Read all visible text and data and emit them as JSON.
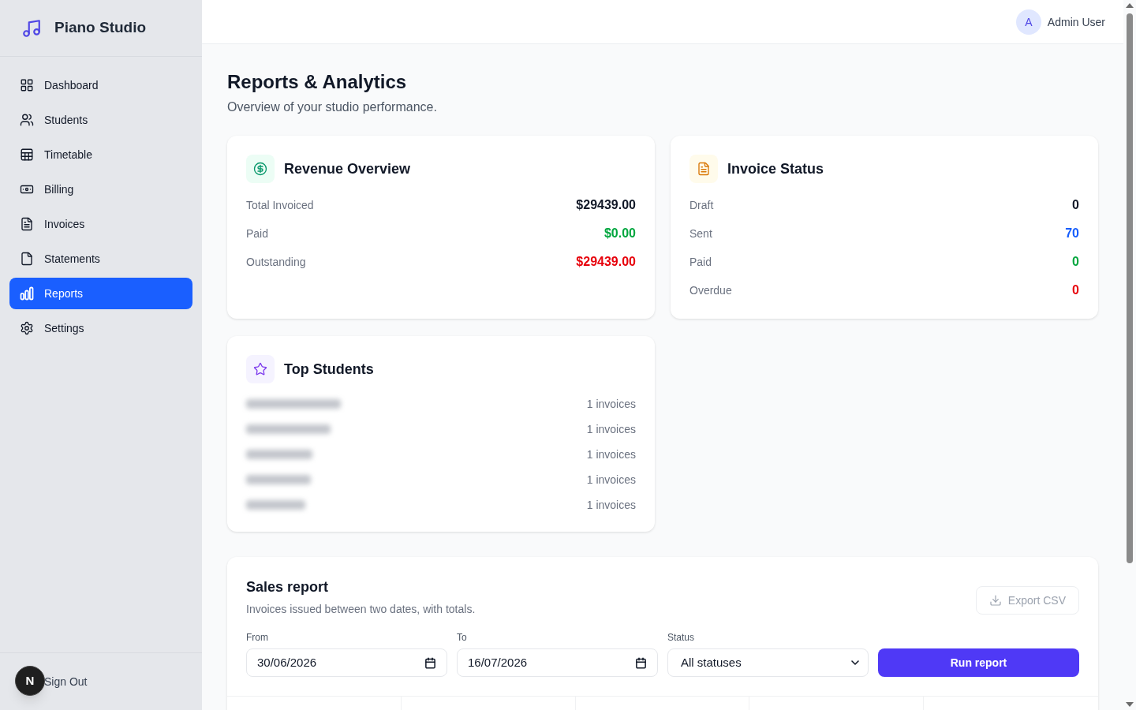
{
  "sidebar": {
    "brand": "Piano Studio",
    "items": [
      {
        "label": "Dashboard",
        "selected": false
      },
      {
        "label": "Students",
        "selected": false
      },
      {
        "label": "Timetable",
        "selected": false
      },
      {
        "label": "Billing",
        "selected": false
      },
      {
        "label": "Invoices",
        "selected": false
      },
      {
        "label": "Statements",
        "selected": false
      },
      {
        "label": "Reports",
        "selected": true
      },
      {
        "label": "Settings",
        "selected": false
      }
    ],
    "sign_out": "Sign Out",
    "dev_badge": "N"
  },
  "header": {
    "avatar_initial": "A",
    "user_name": "Admin User"
  },
  "page": {
    "title": "Reports & Analytics",
    "subtitle": "Overview of your studio performance."
  },
  "revenue": {
    "title": "Revenue Overview",
    "rows": [
      {
        "label": "Total Invoiced",
        "value": "$29439.00",
        "color": "#111827"
      },
      {
        "label": "Paid",
        "value": "$0.00",
        "color": "#00a63e"
      },
      {
        "label": "Outstanding",
        "value": "$29439.00",
        "color": "#e7000b"
      }
    ]
  },
  "invoice_status": {
    "title": "Invoice Status",
    "rows": [
      {
        "label": "Draft",
        "value": "0",
        "color": "#111827"
      },
      {
        "label": "Sent",
        "value": "70",
        "color": "#155dfc"
      },
      {
        "label": "Paid",
        "value": "0",
        "color": "#00a63e"
      },
      {
        "label": "Overdue",
        "value": "0",
        "color": "#e7000b"
      }
    ]
  },
  "top_students": {
    "title": "Top Students",
    "students": [
      {
        "name_blurred": true,
        "invoices": "1 invoices"
      },
      {
        "name_blurred": true,
        "invoices": "1 invoices"
      },
      {
        "name_blurred": true,
        "invoices": "1 invoices"
      },
      {
        "name_blurred": true,
        "invoices": "1 invoices"
      },
      {
        "name_blurred": true,
        "invoices": "1 invoices"
      }
    ]
  },
  "sales_report": {
    "title": "Sales report",
    "subtitle": "Invoices issued between two dates, with totals.",
    "export_button": {
      "label": "Export CSV",
      "disabled": true
    },
    "filters": [
      {
        "kind": "date",
        "label": "From",
        "value": "30/06/2026"
      },
      {
        "kind": "date",
        "label": "To",
        "value": "16/07/2026"
      },
      {
        "kind": "select",
        "label": "Status",
        "value": "All statuses"
      }
    ],
    "run_button": "Run report"
  }
}
